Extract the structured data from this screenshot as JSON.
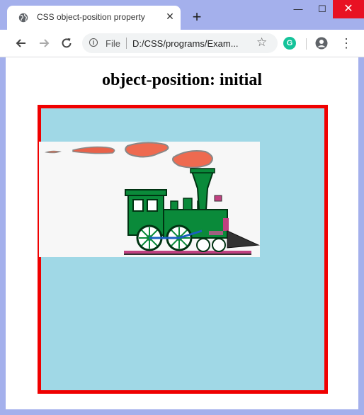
{
  "browser": {
    "tab_title": "CSS object-position property",
    "new_tab_label": "+",
    "close_tab_label": "✕",
    "window_controls": {
      "minimize": "—",
      "maximize": "☐",
      "close": "✕"
    },
    "omnibox": {
      "scheme_label": "File",
      "url": "D:/CSS/programs/Exam..."
    },
    "extension_letter": "G",
    "colors": {
      "frame": "#a4b0ec",
      "close_button": "#e81123",
      "extension": "#15c39a"
    }
  },
  "page": {
    "heading": "object-position: initial",
    "box_background": "#a0d8e6",
    "box_border_color": "#f00000",
    "image_icon": "steam-train-image"
  }
}
